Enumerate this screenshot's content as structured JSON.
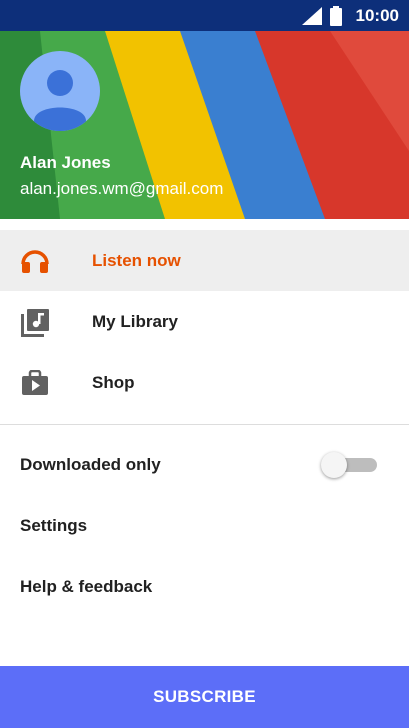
{
  "status_bar": {
    "time": "10:00",
    "signal_icon": "signal-icon",
    "battery_icon": "battery-icon"
  },
  "account": {
    "name": "Alan Jones",
    "email": "alan.jones.wm@gmail.com",
    "avatar_icon": "avatar-person-icon"
  },
  "nav": [
    {
      "label": "Listen now",
      "icon": "headphones-icon",
      "active": true
    },
    {
      "label": "My Library",
      "icon": "music-library-icon",
      "active": false
    },
    {
      "label": "Shop",
      "icon": "shop-bag-icon",
      "active": false
    }
  ],
  "menu": {
    "downloaded_only": {
      "label": "Downloaded only",
      "enabled": false
    },
    "settings": "Settings",
    "help": "Help & feedback"
  },
  "subscribe_label": "SUBSCRIBE",
  "colors": {
    "accent": "#e65100",
    "status_bar": "#0d2f7a",
    "subscribe": "#5c6ef8"
  }
}
